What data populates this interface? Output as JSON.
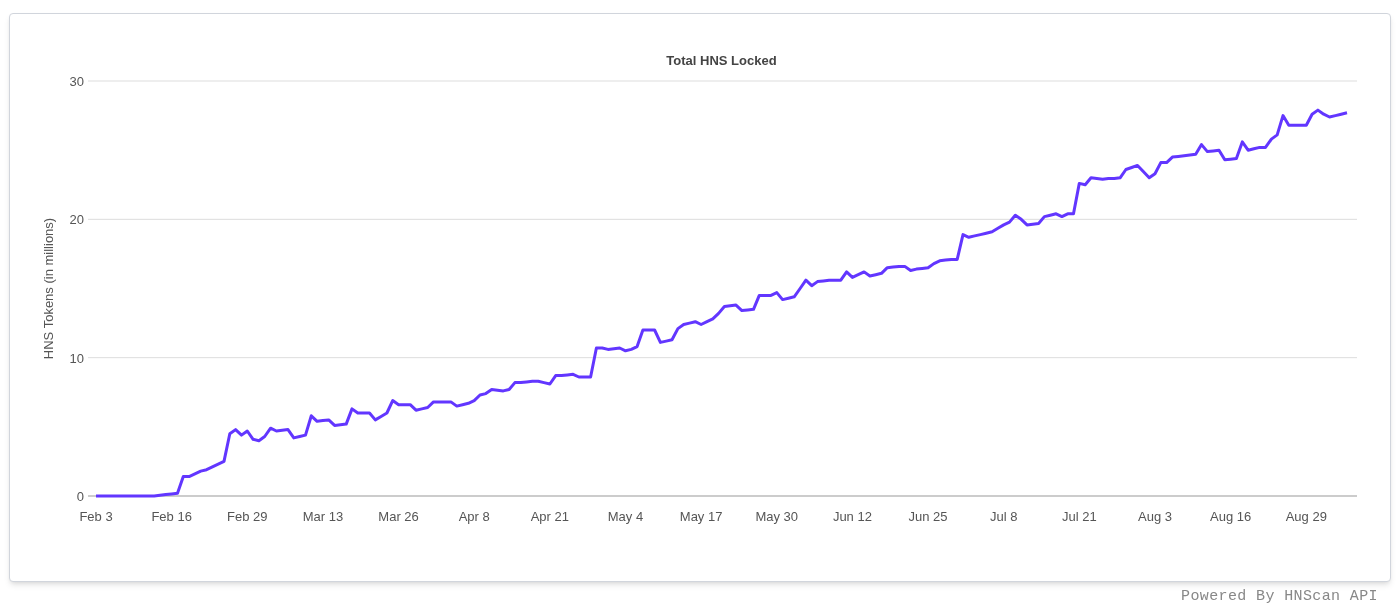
{
  "chart": {
    "chart_data": {
      "type": "line",
      "title": "Total HNS Locked",
      "ylabel": "HNS Tokens (in millions)",
      "categories": [
        "Feb 3",
        null,
        null,
        null,
        null,
        null,
        null,
        null,
        null,
        null,
        null,
        null,
        null,
        "Feb 16",
        null,
        null,
        null,
        null,
        null,
        null,
        null,
        null,
        null,
        null,
        null,
        null,
        "Feb 29",
        null,
        null,
        null,
        null,
        null,
        null,
        null,
        null,
        null,
        null,
        null,
        null,
        "Mar 13",
        null,
        null,
        null,
        null,
        null,
        null,
        null,
        null,
        null,
        null,
        null,
        null,
        "Mar 26",
        null,
        null,
        null,
        null,
        null,
        null,
        null,
        null,
        null,
        null,
        null,
        null,
        "Apr 8",
        null,
        null,
        null,
        null,
        null,
        null,
        null,
        null,
        null,
        null,
        null,
        null,
        "Apr 21",
        null,
        null,
        null,
        null,
        null,
        null,
        null,
        null,
        null,
        null,
        null,
        null,
        "May 4",
        null,
        null,
        null,
        null,
        null,
        null,
        null,
        null,
        null,
        null,
        null,
        null,
        "May 17",
        null,
        null,
        null,
        null,
        null,
        null,
        null,
        null,
        null,
        null,
        null,
        null,
        "May 30",
        null,
        null,
        null,
        null,
        null,
        null,
        null,
        null,
        null,
        null,
        null,
        null,
        "Jun 12",
        null,
        null,
        null,
        null,
        null,
        null,
        null,
        null,
        null,
        null,
        null,
        null,
        "Jun 25",
        null,
        null,
        null,
        null,
        null,
        null,
        null,
        null,
        null,
        null,
        null,
        null,
        "Jul 8",
        null,
        null,
        null,
        null,
        null,
        null,
        null,
        null,
        null,
        null,
        null,
        null,
        "Jul 21",
        null,
        null,
        null,
        null,
        null,
        null,
        null,
        null,
        null,
        null,
        null,
        null,
        "Aug 3",
        null,
        null,
        null,
        null,
        null,
        null,
        null,
        null,
        null,
        null,
        null,
        null,
        "Aug 16",
        null,
        null,
        null,
        null,
        null,
        null,
        null,
        null,
        null,
        null,
        null,
        null,
        "Aug 29",
        null,
        null,
        null,
        null,
        null,
        null,
        null
      ],
      "series": [
        {
          "color": "#6236ff",
          "values": [
            0,
            0,
            0,
            0,
            0,
            0,
            0,
            0,
            0,
            0,
            0,
            0.05,
            0.1,
            0.15,
            0.2,
            1.4,
            1.4,
            1.6,
            1.8,
            1.9,
            2.1,
            2.3,
            2.5,
            4.5,
            4.8,
            4.4,
            4.7,
            4.1,
            4.0,
            4.3,
            4.9,
            4.7,
            4.75,
            4.8,
            4.2,
            4.3,
            4.4,
            5.8,
            5.4,
            5.45,
            5.5,
            5.1,
            5.15,
            5.2,
            6.3,
            6.0,
            6.0,
            6.0,
            5.5,
            5.75,
            6.0,
            6.9,
            6.6,
            6.6,
            6.6,
            6.2,
            6.3,
            6.4,
            6.8,
            6.8,
            6.8,
            6.8,
            6.5,
            6.6,
            6.7,
            6.9,
            7.3,
            7.4,
            7.7,
            7.65,
            7.6,
            7.7,
            8.2,
            8.2,
            8.25,
            8.3,
            8.3,
            8.2,
            8.1,
            8.7,
            8.7,
            8.75,
            8.8,
            8.6,
            8.6,
            8.6,
            10.7,
            10.7,
            10.6,
            10.65,
            10.7,
            10.5,
            10.6,
            10.8,
            12.0,
            12.0,
            12.0,
            11.1,
            11.2,
            11.3,
            12.1,
            12.4,
            12.5,
            12.6,
            12.4,
            12.6,
            12.8,
            13.2,
            13.7,
            13.75,
            13.8,
            13.4,
            13.45,
            13.5,
            14.5,
            14.5,
            14.5,
            14.7,
            14.2,
            14.3,
            14.4,
            15.0,
            15.6,
            15.2,
            15.5,
            15.55,
            15.6,
            15.6,
            15.6,
            16.2,
            15.8,
            16.0,
            16.2,
            15.9,
            16.0,
            16.1,
            16.5,
            16.55,
            16.6,
            16.6,
            16.3,
            16.4,
            16.45,
            16.5,
            16.8,
            17.0,
            17.05,
            17.1,
            17.1,
            18.9,
            18.7,
            18.8,
            18.9,
            19.0,
            19.1,
            19.35,
            19.6,
            19.8,
            20.3,
            20.0,
            19.6,
            19.65,
            19.7,
            20.2,
            20.3,
            20.4,
            20.2,
            20.4,
            20.4,
            22.6,
            22.5,
            23.0,
            22.95,
            22.9,
            22.95,
            22.95,
            23.0,
            23.6,
            23.75,
            23.9,
            23.45,
            23.0,
            23.3,
            24.1,
            24.1,
            24.5,
            24.55,
            24.6,
            24.65,
            24.7,
            25.4,
            24.9,
            24.95,
            25.0,
            24.3,
            24.35,
            24.4,
            25.6,
            25.0,
            25.1,
            25.2,
            25.2,
            25.8,
            26.1,
            27.5,
            26.8,
            26.8,
            26.8,
            26.8,
            27.6,
            27.9,
            27.6,
            27.4,
            27.5,
            27.6,
            27.7
          ]
        }
      ],
      "ylim": [
        0,
        30
      ],
      "yticks": [
        0,
        10,
        20,
        30
      ]
    }
  },
  "footer": "Powered By HNScan API"
}
